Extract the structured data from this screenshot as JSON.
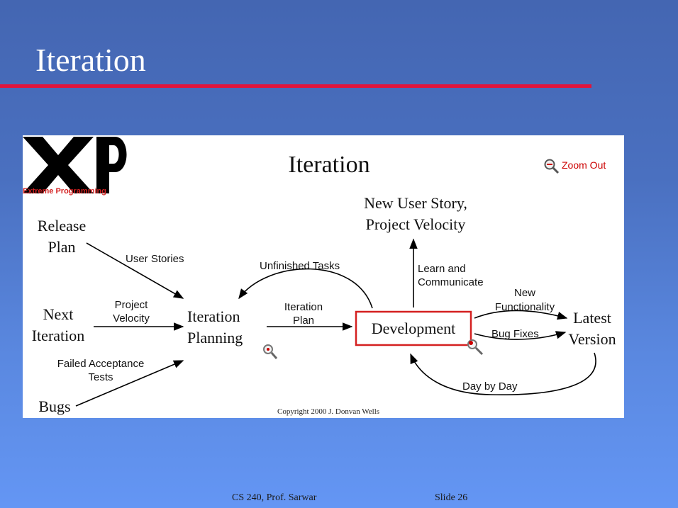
{
  "slide": {
    "title": "Iteration",
    "footer_left": "CS 240, Prof. Sarwar",
    "footer_right": "Slide  26"
  },
  "diagram": {
    "logo_text": "Extreme Programming",
    "title": "Iteration",
    "zoom_out_label": "Zoom Out",
    "nodes": {
      "release_plan": [
        "Release",
        "Plan"
      ],
      "next_iteration": [
        "Next",
        "Iteration"
      ],
      "bugs": "Bugs",
      "iteration_planning": [
        "Iteration",
        "Planning"
      ],
      "development": "Development",
      "new_user_story": [
        "New User Story,",
        "Project Velocity"
      ],
      "latest_version": [
        "Latest",
        "Version"
      ]
    },
    "edge_labels": {
      "user_stories": "User Stories",
      "project_velocity": [
        "Project",
        "Velocity"
      ],
      "failed_acceptance_tests": [
        "Failed Acceptance",
        "Tests"
      ],
      "unfinished_tasks": "Unfinished Tasks",
      "iteration_plan": [
        "Iteration",
        "Plan"
      ],
      "learn_and_communicate": [
        "Learn and",
        "Communicate"
      ],
      "new_functionality": [
        "New",
        "Functionality"
      ],
      "bug_fixes": "Bug Fixes",
      "day_by_day": "Day by Day"
    },
    "copyright": "Copyright 2000 J. Donvan Wells",
    "colors": {
      "development_border": "#d42020",
      "logo_text": "#d42020",
      "zoom_out_text": "#cc0000"
    }
  }
}
